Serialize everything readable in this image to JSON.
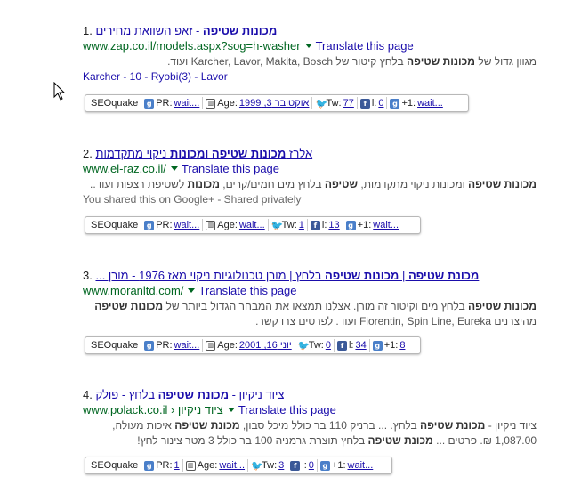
{
  "results": [
    {
      "number": "1.",
      "title_pre": "",
      "title_bold": "מכונות שטיפה",
      "title_post": " - זאפ השוואת מחירים",
      "url": "www.zap.co.il/models.aspx?sog=h-washer",
      "translate": "Translate this page",
      "snippet1_a": "מגוון גדול של ",
      "snippet1_b": "מכונות שטיפה",
      "snippet1_c": " בלחץ קיטור של Karcher, Lavor, Makita, Bosch ועוד.",
      "sitelinks": "Karcher - 10 - Ryobi(3) - Lavor",
      "seo": {
        "brand": "SEOquake",
        "pr_label": "PR:",
        "pr": "wait...",
        "age_label": "Age:",
        "age": "אוקטובר 3, 1999",
        "tw_label": "Tw:",
        "tw": "77",
        "fb_label": "l:",
        "fb": "0",
        "gp_label": "+1:",
        "gp": "wait..."
      }
    },
    {
      "number": "2.",
      "title_pre": "אלרז ",
      "title_bold": "מכונות שטיפה ומכונות",
      "title_post": " ניקוי מתקדמות",
      "url": "www.el-raz.co.il/",
      "translate": "Translate this page",
      "snippet1_a": "מכונות שטיפה",
      "snippet1_b": " ומכונות ניקוי מתקדמות, ",
      "snippet1_c": "שטיפה",
      "snippet1_d": " בלחץ מים חמים/קרים, ",
      "snippet1_e": "מכונות",
      "snippet1_f": " לשטיפת רצפות ועוד..",
      "shared": "You shared this on Google+ - Shared privately",
      "seo": {
        "brand": "SEOquake",
        "pr_label": "PR:",
        "pr": "wait...",
        "age_label": "Age:",
        "age": "wait...",
        "tw_label": "Tw:",
        "tw": "1",
        "fb_label": "l:",
        "fb": "13",
        "gp_label": "+1:",
        "gp": "wait..."
      }
    },
    {
      "number": "3.",
      "title_bold1": "מכונת שטיפה",
      "title_mid1": " | ",
      "title_bold2": "מכונות שטיפה",
      "title_post": " בלחץ | מורן טכנולוגיות ניקוי מאז 1976 - מורן ...",
      "url": "www.moranltd.com/",
      "translate": "Translate this page",
      "snippet1_a": "מכונות שטיפה",
      "snippet1_b": " בלחץ מים וקיטור זה מורן. אצלנו תמצאו את המבחר הגדול ביותר של ",
      "snippet1_c": "מכונות שטיפה",
      "snippet2": "מהיצרנים Fiorentin, Spin Line, Eureka ועוד. לפרטים צרו קשר.",
      "seo": {
        "brand": "SEOquake",
        "pr_label": "PR:",
        "pr": "wait...",
        "age_label": "Age:",
        "age": "יוני 16, 2001",
        "tw_label": "Tw:",
        "tw": "0",
        "fb_label": "l:",
        "fb": "34",
        "gp_label": "+1:",
        "gp": "8"
      }
    },
    {
      "number": "4.",
      "title_pre": "ציוד ניקיון - ",
      "title_bold": "מכונת שטיפה",
      "title_post": " בלחץ - פולק",
      "url": "www.polack.co.il › ציוד ניקיון",
      "translate": "Translate this page",
      "snippet1_a": "ציוד ניקיון - ",
      "snippet1_b": "מכונת שטיפה",
      "snippet1_c": " בלחץ. ... ברניק 110 בר כולל מיכל סבון, ",
      "snippet1_d": "מכונת שטיפה",
      "snippet1_e": " איכות מעולה,",
      "snippet2_a": "1,087.00 ₪. פרטים ... ",
      "snippet2_b": "מכונת שטיפה",
      "snippet2_c": " בלחץ תוצרת גרמניה 100 בר כולל 3 מטר צינור לחץ!",
      "seo": {
        "brand": "SEOquake",
        "pr_label": "PR:",
        "pr": "1",
        "age_label": "Age:",
        "age": "wait...",
        "tw_label": "Tw:",
        "tw": "3",
        "fb_label": "l:",
        "fb": "0",
        "gp_label": "+1:",
        "gp": "wait..."
      }
    }
  ],
  "colors": {
    "link": "#1a0dab",
    "url": "#006621",
    "snippet": "#545454"
  }
}
